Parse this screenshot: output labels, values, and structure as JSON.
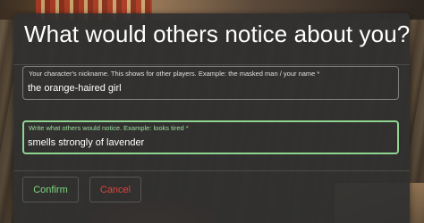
{
  "dialog": {
    "title": "What would others notice about you?",
    "fields": [
      {
        "label": "Your character's nickname. This shows for other players. Example: the masked man / your name *",
        "value": "the orange-haired girl"
      },
      {
        "label": "Write what others would notice. Example: looks tired *",
        "value": "smells strongly of lavender"
      }
    ],
    "buttons": {
      "confirm": "Confirm",
      "cancel": "Cancel"
    }
  },
  "colors": {
    "accent_green": "#8fd48f",
    "cancel_red": "#e0443a",
    "dialog_bg": "#303030"
  }
}
